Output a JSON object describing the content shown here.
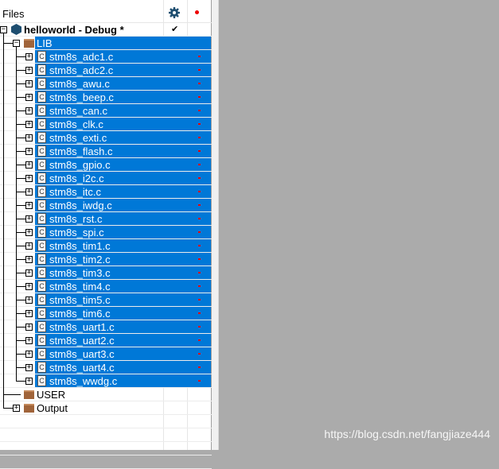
{
  "header": {
    "title": "Files",
    "gear_icon": "gear-icon",
    "breakpoint_icon": "red-dot-icon"
  },
  "project": {
    "name": "helloworld - Debug *",
    "check": "✔"
  },
  "groups": {
    "lib": "LIB",
    "user": "USER",
    "output": "Output"
  },
  "files": [
    "stm8s_adc1.c",
    "stm8s_adc2.c",
    "stm8s_awu.c",
    "stm8s_beep.c",
    "stm8s_can.c",
    "stm8s_clk.c",
    "stm8s_exti.c",
    "stm8s_flash.c",
    "stm8s_gpio.c",
    "stm8s_i2c.c",
    "stm8s_itc.c",
    "stm8s_iwdg.c",
    "stm8s_rst.c",
    "stm8s_spi.c",
    "stm8s_tim1.c",
    "stm8s_tim2.c",
    "stm8s_tim3.c",
    "stm8s_tim4.c",
    "stm8s_tim5.c",
    "stm8s_tim6.c",
    "stm8s_uart1.c",
    "stm8s_uart2.c",
    "stm8s_uart3.c",
    "stm8s_uart4.c",
    "stm8s_wwdg.c"
  ],
  "file_icon_letter": "C",
  "expand_glyph": "+",
  "collapse_glyph": "−",
  "watermark": "https://blog.csdn.net/fangjiaze444",
  "colors": {
    "selection": "#0078d7",
    "project_icon": "#1e4e70",
    "folder": "#a0643a",
    "dot": "#e00000"
  }
}
